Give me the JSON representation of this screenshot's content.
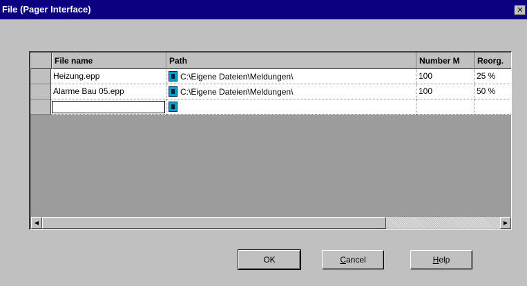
{
  "window": {
    "title": "File (Pager Interface)",
    "close_glyph": "✕"
  },
  "grid": {
    "columns": [
      {
        "label": "File name"
      },
      {
        "label": "Path"
      },
      {
        "label": "Number M"
      },
      {
        "label": "Reorg."
      }
    ],
    "rows": [
      {
        "file_name": "Heizung.epp",
        "path": "C:\\Eigene Dateien\\Meldungen\\",
        "number": "100",
        "reorg": "25 %"
      },
      {
        "file_name": "Alarme Bau 05.epp",
        "path": "C:\\Eigene Dateien\\Meldungen\\",
        "number": "100",
        "reorg": "50 %"
      },
      {
        "file_name": "",
        "path": "",
        "number": "",
        "reorg": ""
      }
    ],
    "path_icon": "folder-browse-icon"
  },
  "buttons": {
    "ok": {
      "label": "OK"
    },
    "cancel": {
      "accel": "C",
      "rest": "ancel"
    },
    "help": {
      "accel": "H",
      "rest": "elp"
    }
  },
  "scrollbar": {
    "left_glyph": "◀",
    "right_glyph": "▶"
  }
}
